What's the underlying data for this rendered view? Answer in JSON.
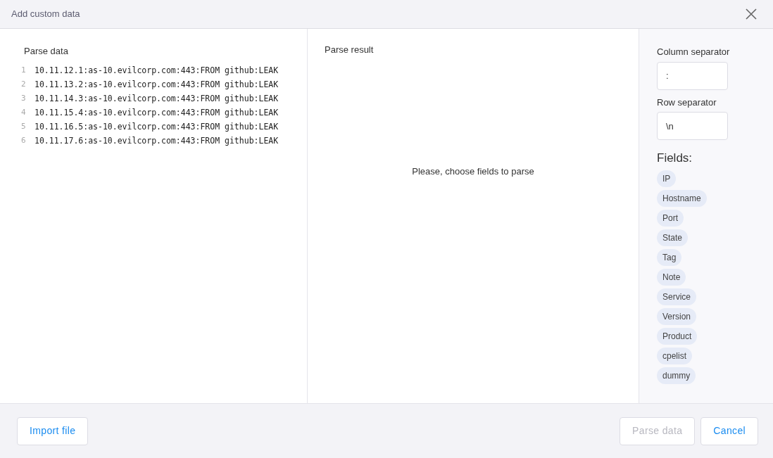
{
  "window": {
    "title": "Add custom data"
  },
  "parse_data": {
    "label": "Parse data",
    "lines": [
      {
        "number": "1",
        "text": "10.11.12.1:as-10.evilcorp.com:443:FROM github:LEAK"
      },
      {
        "number": "2",
        "text": "10.11.13.2:as-10.evilcorp.com:443:FROM github:LEAK"
      },
      {
        "number": "3",
        "text": "10.11.14.3:as-10.evilcorp.com:443:FROM github:LEAK"
      },
      {
        "number": "4",
        "text": "10.11.15.4:as-10.evilcorp.com:443:FROM github:LEAK"
      },
      {
        "number": "5",
        "text": "10.11.16.5:as-10.evilcorp.com:443:FROM github:LEAK"
      },
      {
        "number": "6",
        "text": "10.11.17.6:as-10.evilcorp.com:443:FROM github:LEAK"
      }
    ]
  },
  "parse_result": {
    "label": "Parse result",
    "message": "Please, choose fields to parse"
  },
  "settings": {
    "column_separator": {
      "label": "Column separator",
      "value": ":"
    },
    "row_separator": {
      "label": "Row separator",
      "value": "\\n"
    },
    "fields_label": "Fields:",
    "fields": [
      "IP",
      "Hostname",
      "Port",
      "State",
      "Tag",
      "Note",
      "Service",
      "Version",
      "Product",
      "cpelist",
      "dummy"
    ]
  },
  "footer": {
    "import_button": {
      "label": "Import file",
      "disabled": false
    },
    "parse_button": {
      "label": "Parse data",
      "disabled": true
    },
    "cancel_button": {
      "label": "Cancel",
      "disabled": false
    }
  }
}
